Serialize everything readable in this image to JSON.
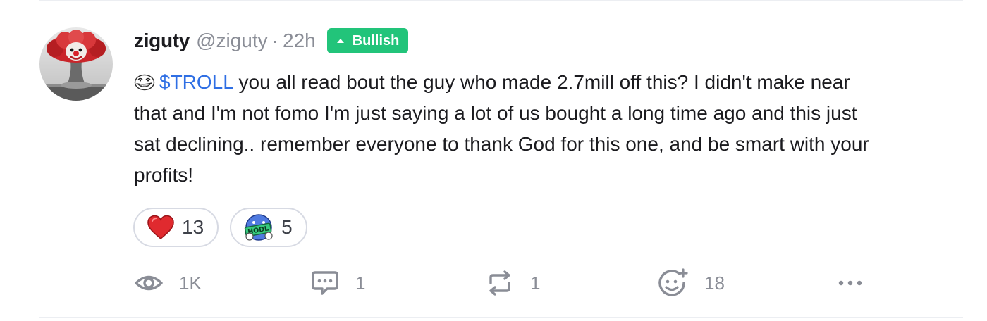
{
  "post": {
    "author": {
      "display_name": "ziguty",
      "handle": "@ziguty",
      "separator": "·",
      "time": "22h"
    },
    "sentiment_badge": {
      "label": "Bullish",
      "color": "#22c47a"
    },
    "body": {
      "emoji_icon": "troll-face-icon",
      "cashtag": "$TROLL",
      "text": " you all read bout the guy who made 2.7mill off this? I didn't make near that and I'm not fomo I'm just saying a lot of us bought a long time ago and this just sat declining.. remember everyone to thank God for this one, and be smart with your profits!"
    },
    "reactions": [
      {
        "icon": "red-heart-icon",
        "count": "13"
      },
      {
        "icon": "hodl-emoji-icon",
        "count": "5"
      }
    ],
    "actions": {
      "views": {
        "icon": "eye-icon",
        "count": "1K"
      },
      "comments": {
        "icon": "comment-icon",
        "count": "1"
      },
      "reposts": {
        "icon": "repost-icon",
        "count": "1"
      },
      "add_reaction": {
        "icon": "add-reaction-icon",
        "count": "18"
      },
      "more": {
        "icon": "more-icon"
      }
    }
  },
  "colors": {
    "cashtag": "#2f6fe4",
    "muted_text": "#8a8d96",
    "divider": "#eceef2"
  }
}
